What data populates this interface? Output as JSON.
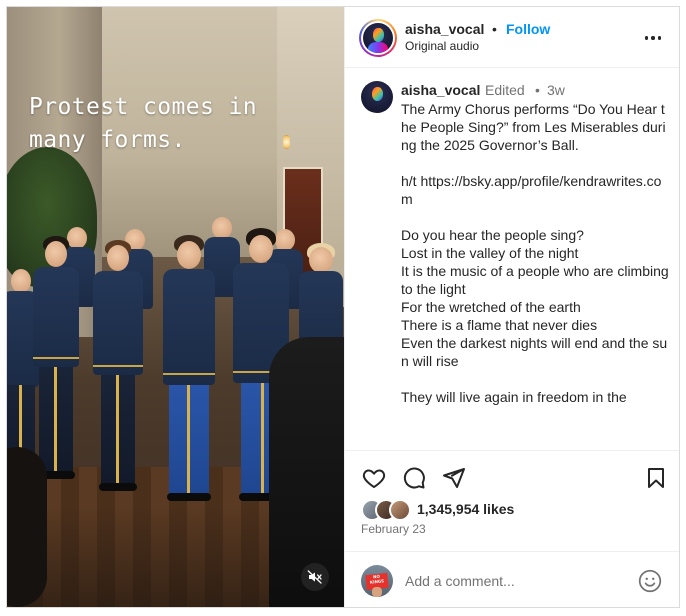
{
  "post": {
    "overlay_text": "Protest comes in\nmany forms.",
    "media_icons": {
      "mute": "speaker-muted-icon"
    }
  },
  "header": {
    "username": "aisha_vocal",
    "separator": "•",
    "follow_label": "Follow",
    "audio_label": "Original audio",
    "more_icon": "more-horizontal-icon"
  },
  "caption": {
    "username": "aisha_vocal",
    "edited_label": "Edited",
    "separator": "•",
    "time": "3w",
    "text": "The Army Chorus performs “Do You Hear the People Sing?” from Les Miserables during the 2025 Governor’s Ball.\n\nh/t https://bsky.app/profile/kendrawrites.com\n\nDo you hear the people sing?\nLost in the valley of the night\nIt is the music of a people who are climbing to the light\nFor the wretched of the earth\nThere is a flame that never dies\nEven the darkest nights will end and the sun will rise\n\nThey will live again in freedom in the"
  },
  "actions": {
    "icons": [
      "heart-icon",
      "comment-icon",
      "share-icon",
      "bookmark-icon"
    ],
    "likes": "1,345,954 likes",
    "date": "February 23"
  },
  "comment": {
    "placeholder": "Add a comment...",
    "emoji_icon": "smiley-icon"
  },
  "colors": {
    "accent": "#0095f6",
    "text": "#262626",
    "muted": "#737373",
    "border": "#dbdbdb"
  }
}
